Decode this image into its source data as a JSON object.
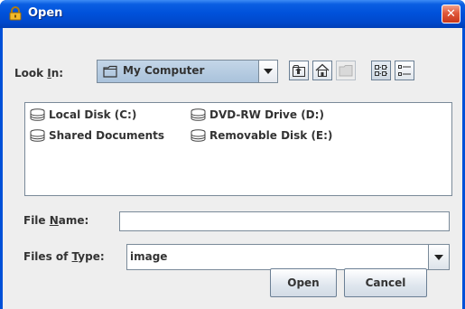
{
  "window": {
    "title": "Open",
    "close_glyph": "✕"
  },
  "look_in": {
    "label_pre": "Look ",
    "label_mnemonic": "I",
    "label_post": "n:",
    "value": "My Computer"
  },
  "toolbar": {
    "buttons": [
      {
        "name": "up-one-level-icon",
        "enabled": true
      },
      {
        "name": "home-icon",
        "enabled": true
      },
      {
        "name": "new-folder-icon",
        "enabled": false
      },
      {
        "name": "list-view-icon",
        "enabled": true,
        "selected": true
      },
      {
        "name": "details-view-icon",
        "enabled": true
      }
    ]
  },
  "files": [
    {
      "label": "Local Disk (C:)",
      "icon": "drive-icon"
    },
    {
      "label": "DVD-RW Drive (D:)",
      "icon": "drive-icon"
    },
    {
      "label": "Shared Documents",
      "icon": "drive-icon"
    },
    {
      "label": "Removable Disk (E:)",
      "icon": "drive-icon"
    }
  ],
  "file_name": {
    "label_pre": "File ",
    "label_mnemonic": "N",
    "label_post": "ame:",
    "value": ""
  },
  "file_type": {
    "label_pre": "Files of ",
    "label_mnemonic": "T",
    "label_post": "ype:",
    "value": "image"
  },
  "actions": {
    "open_label": "Open",
    "cancel_label": "Cancel"
  },
  "colors": {
    "titlebar": "#0052db",
    "client_bg": "#eeeeee",
    "close": "#e0583a"
  }
}
